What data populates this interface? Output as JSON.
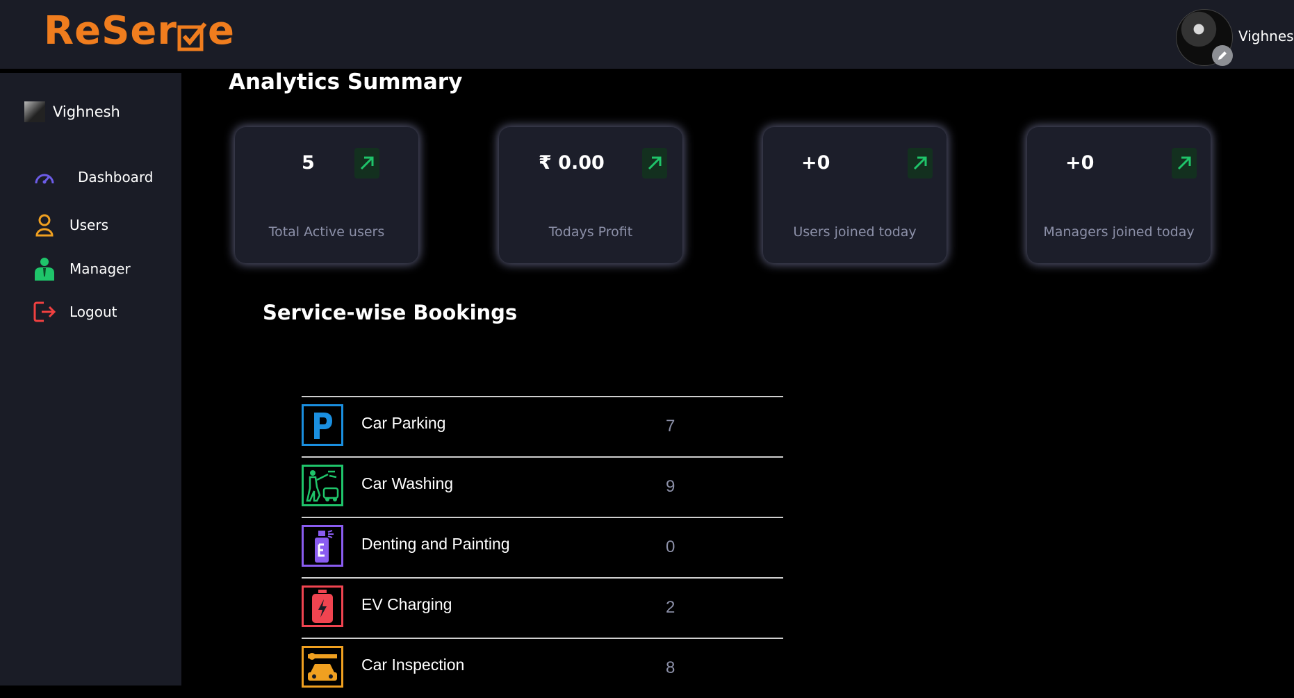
{
  "app": {
    "logo_text": "ReSer",
    "logo_tail": "e"
  },
  "header": {
    "username": "Vighnesh",
    "avatar_icon": "user-avatar",
    "edit_icon": "pencil-icon"
  },
  "sidebar": {
    "username": "Vighnesh",
    "items": [
      {
        "label": "Dashboard",
        "icon": "speedometer-icon",
        "color": "#6c5ce7"
      },
      {
        "label": "Users",
        "icon": "user-icon",
        "color": "#f0a020"
      },
      {
        "label": "Manager",
        "icon": "manager-icon",
        "color": "#1fc46a"
      },
      {
        "label": "Logout",
        "icon": "logout-icon",
        "color": "#f04040"
      }
    ]
  },
  "main": {
    "title": "Analytics Summary",
    "cards": [
      {
        "value": "5",
        "caption": "Total Active users"
      },
      {
        "value": "₹ 0.00",
        "caption": "Todays Profit"
      },
      {
        "value": "+0",
        "caption": "Users joined today"
      },
      {
        "value": "+0",
        "caption": "Managers joined today"
      }
    ],
    "services_title": "Service-wise Bookings",
    "services": [
      {
        "name": "Car Parking",
        "count": "7",
        "icon": "parking-icon",
        "color": "#1a8fe0"
      },
      {
        "name": "Car Washing",
        "count": "9",
        "icon": "car-wash-icon",
        "color": "#1fc46a"
      },
      {
        "name": "Denting and Painting",
        "count": "0",
        "icon": "spray-paint-icon",
        "color": "#8a5cf0"
      },
      {
        "name": "EV Charging",
        "count": "2",
        "icon": "battery-charging-icon",
        "color": "#f04450"
      },
      {
        "name": "Car Inspection",
        "count": "8",
        "icon": "car-inspection-icon",
        "color": "#f0a020"
      }
    ]
  },
  "colors": {
    "accent": "#f07d1e",
    "panel": "#1a1c26",
    "trend_green": "#1fc46a"
  }
}
